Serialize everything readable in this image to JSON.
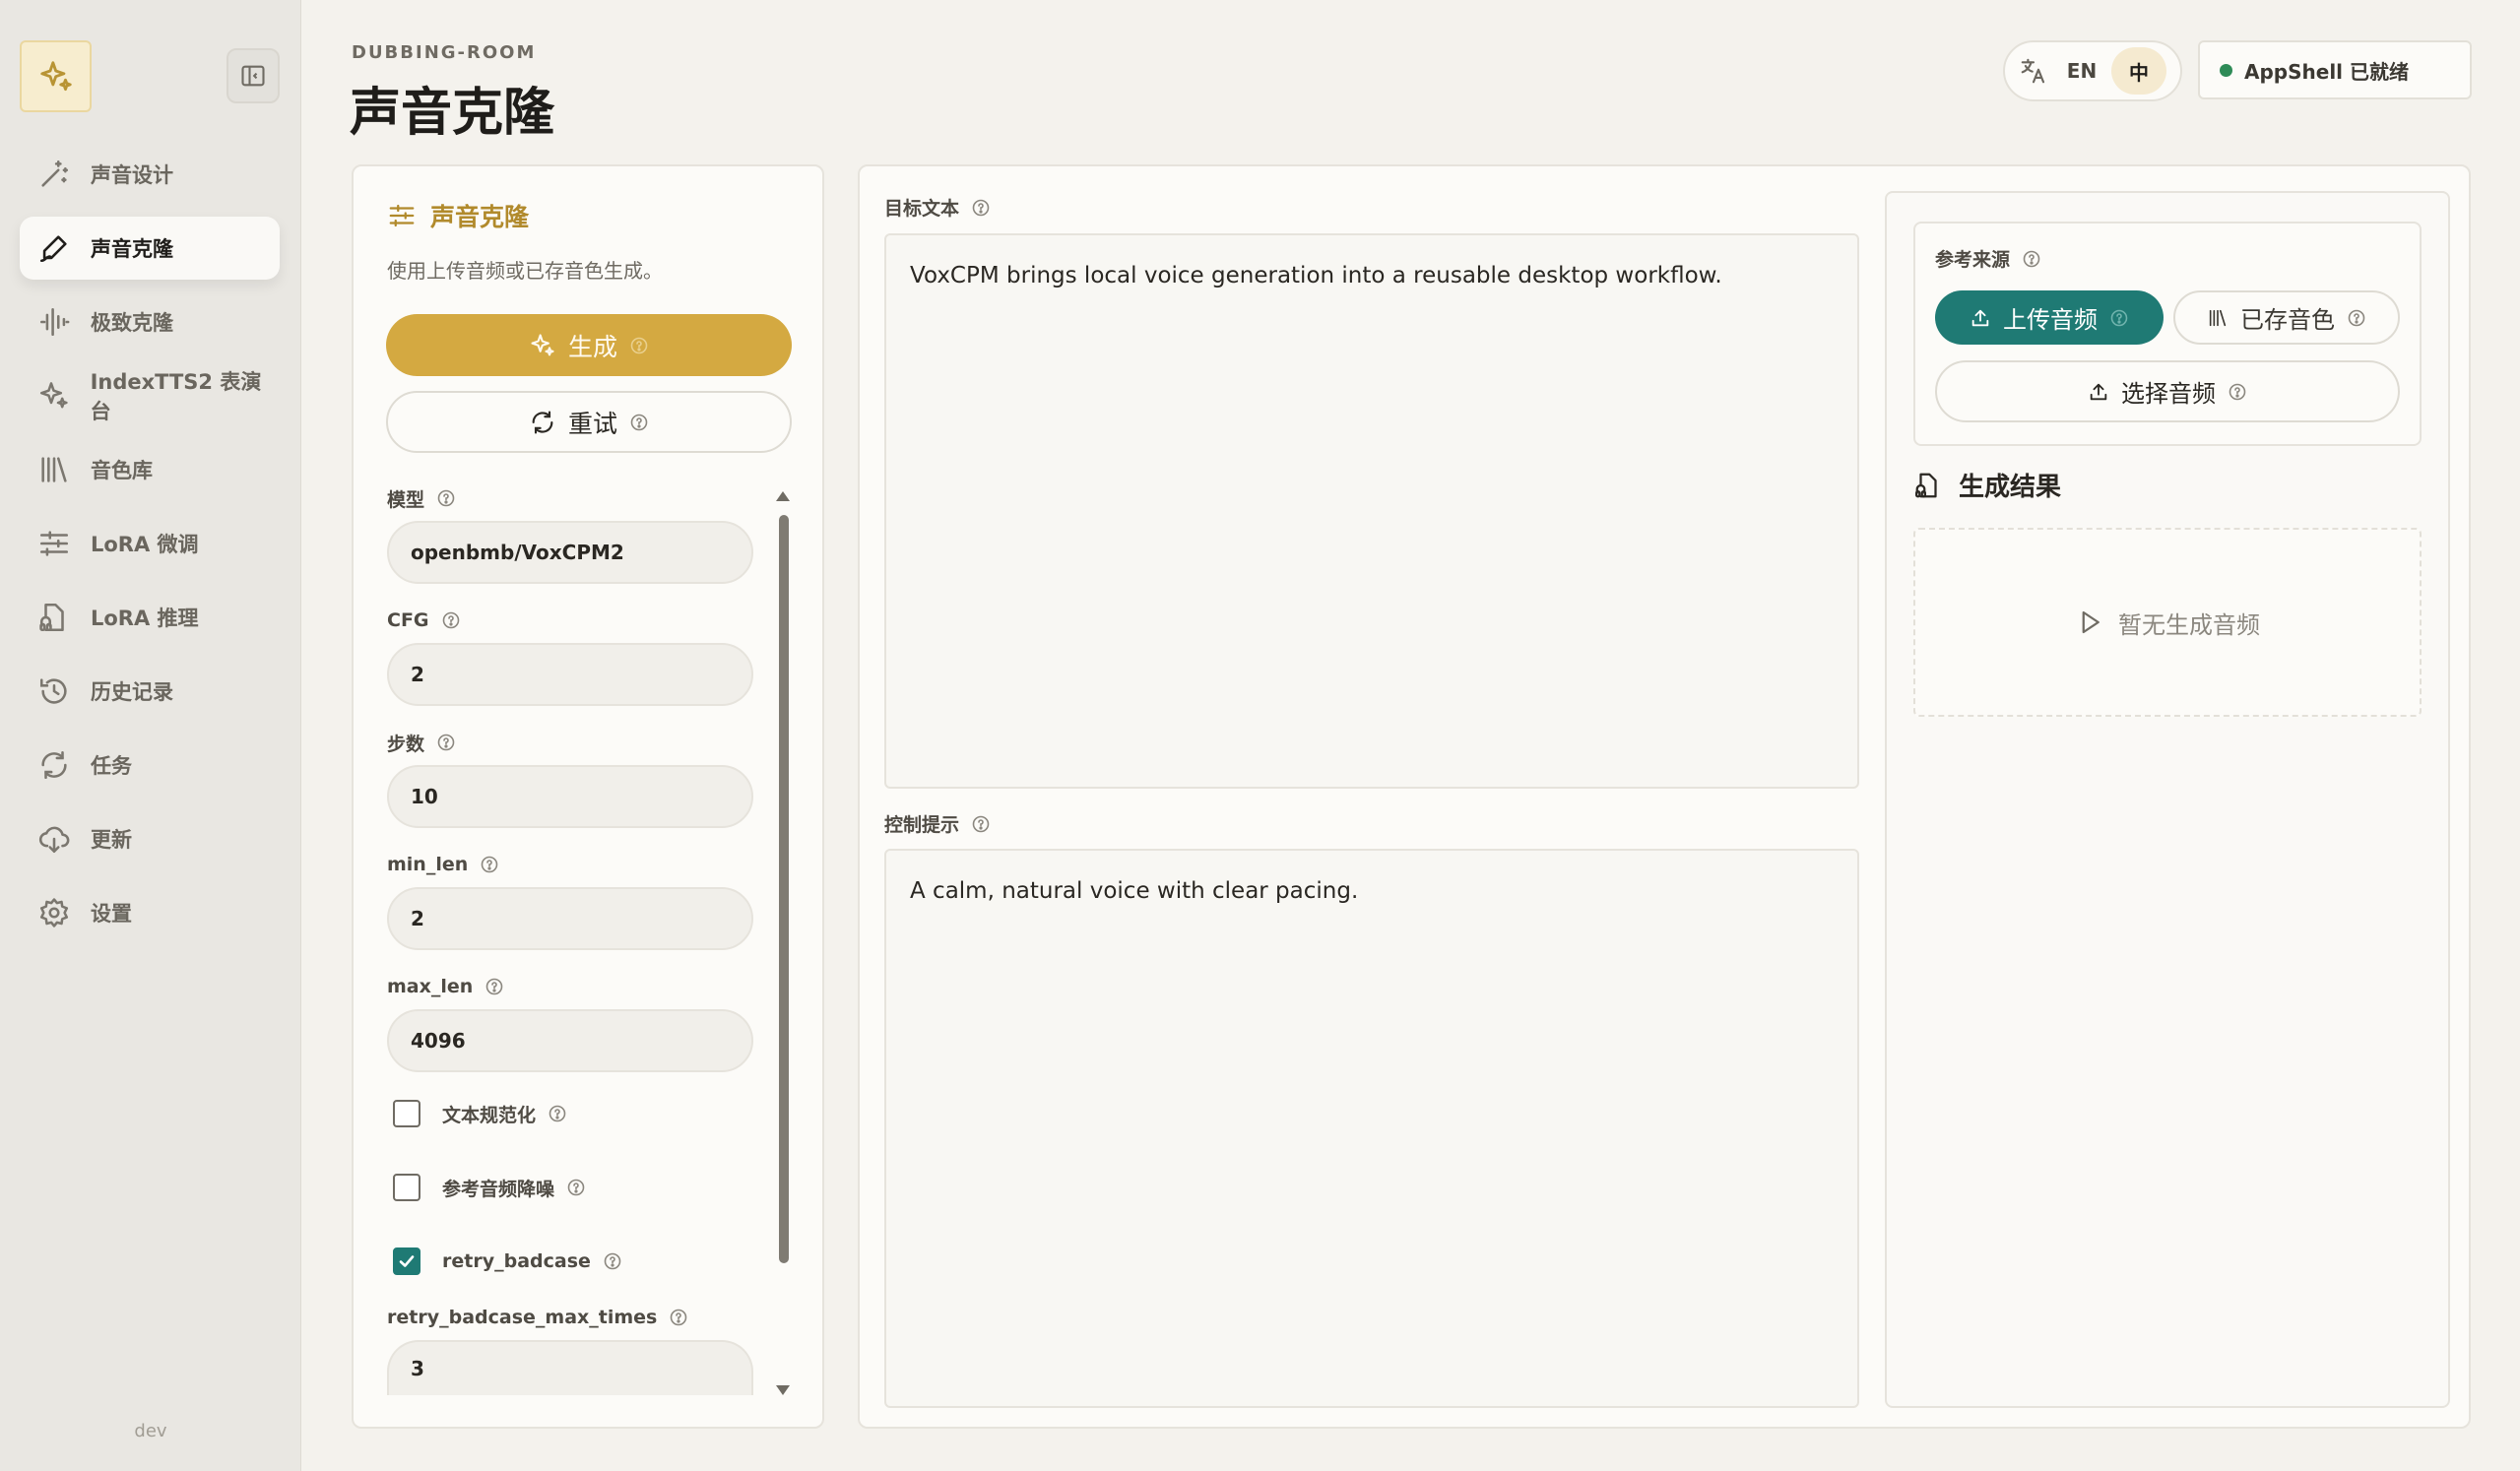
{
  "sidebar": {
    "items": [
      {
        "label": "声音设计",
        "icon": "magic-wand-icon",
        "active": false
      },
      {
        "label": "声音克隆",
        "icon": "pen-icon",
        "active": true
      },
      {
        "label": "极致克隆",
        "icon": "waveform-icon",
        "active": false
      },
      {
        "label": "IndexTTS2 表演台",
        "icon": "sparkles-icon",
        "active": false
      },
      {
        "label": "音色库",
        "icon": "library-icon",
        "active": false
      },
      {
        "label": "LoRA 微调",
        "icon": "sliders-icon",
        "active": false
      },
      {
        "label": "LoRA 推理",
        "icon": "audio-file-icon",
        "active": false
      },
      {
        "label": "历史记录",
        "icon": "history-icon",
        "active": false
      },
      {
        "label": "任务",
        "icon": "refresh-icon",
        "active": false
      },
      {
        "label": "更新",
        "icon": "cloud-download-icon",
        "active": false
      },
      {
        "label": "设置",
        "icon": "gear-icon",
        "active": false
      }
    ],
    "footer": "dev"
  },
  "header": {
    "eyebrow": "DUBBING-ROOM",
    "title": "声音克隆",
    "lang": {
      "en": "EN",
      "zh": "中",
      "selected": "中"
    },
    "status": "AppShell 已就绪"
  },
  "left_panel": {
    "title": "声音克隆",
    "subtitle": "使用上传音频或已存音色生成。",
    "generate_label": "生成",
    "retry_label": "重试",
    "fields": [
      {
        "label": "模型",
        "value": "openbmb/VoxCPM2"
      },
      {
        "label": "CFG",
        "value": "2"
      },
      {
        "label": "步数",
        "value": "10"
      },
      {
        "label": "min_len",
        "value": "2"
      },
      {
        "label": "max_len",
        "value": "4096"
      }
    ],
    "checks": [
      {
        "label": "文本规范化",
        "checked": false
      },
      {
        "label": "参考音频降噪",
        "checked": false
      },
      {
        "label": "retry_badcase",
        "checked": true
      }
    ],
    "last_field": {
      "label": "retry_badcase_max_times",
      "value": "3"
    }
  },
  "main": {
    "target_text_label": "目标文本",
    "target_text": "VoxCPM brings local voice generation into a reusable desktop workflow.",
    "control_label": "控制提示",
    "control_text": "A calm, natural voice with clear pacing."
  },
  "reference": {
    "label": "参考来源",
    "tab_upload": "上传音频",
    "tab_saved": "已存音色",
    "choose_label": "选择音频",
    "active_tab": "上传音频"
  },
  "result": {
    "title": "生成结果",
    "empty": "暂无生成音频"
  },
  "colors": {
    "accent_gold": "#d4a941",
    "accent_teal": "#1f7a74",
    "status_green": "#2e8b57"
  }
}
